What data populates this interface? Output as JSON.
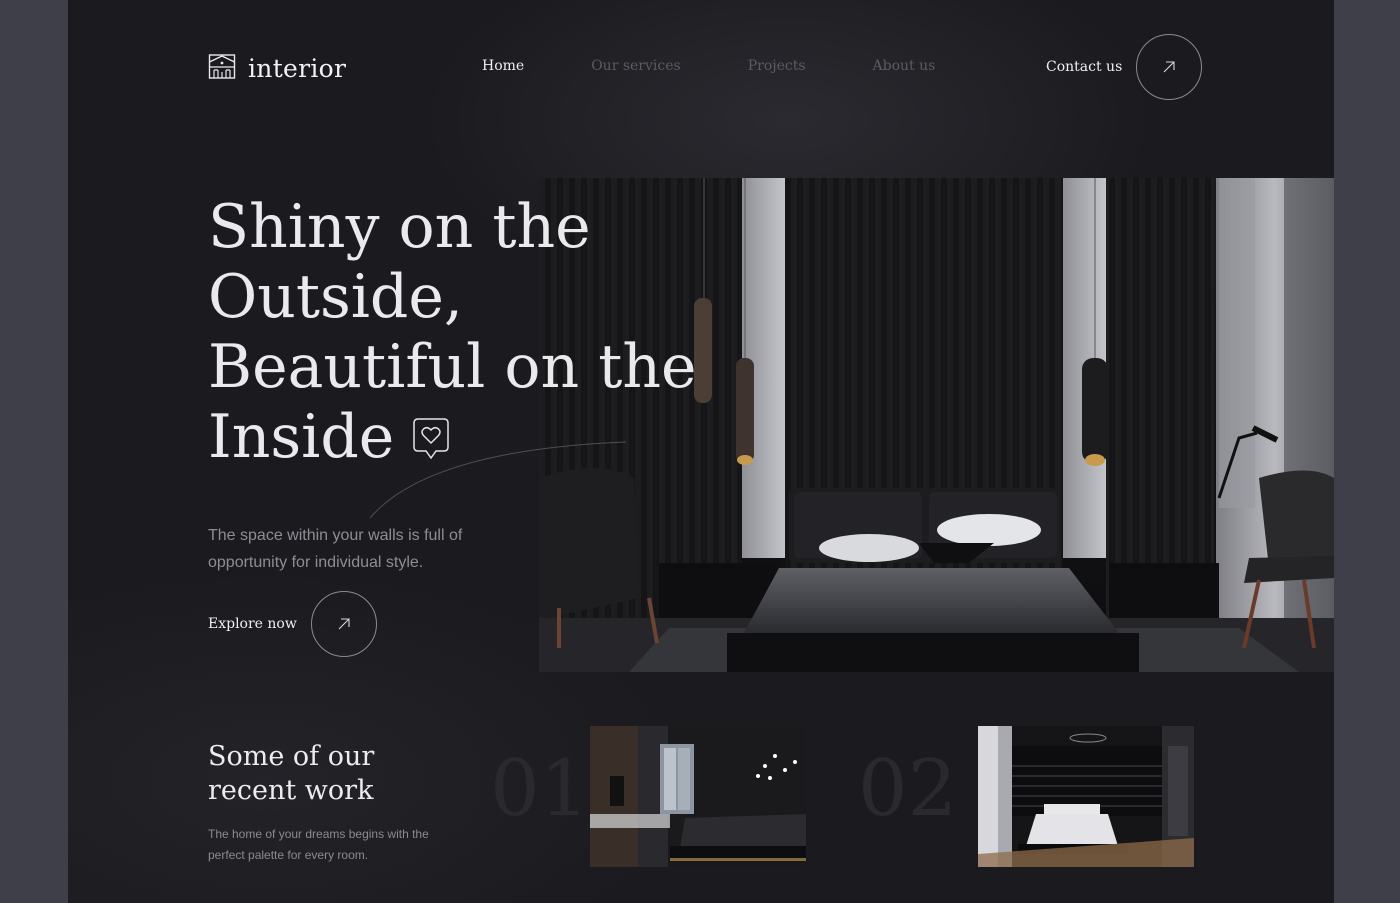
{
  "brand": {
    "name": "interior",
    "icon": "house-logo-icon"
  },
  "nav": {
    "items": [
      {
        "label": "Home",
        "active": true
      },
      {
        "label": "Our services",
        "active": false
      },
      {
        "label": "Projects",
        "active": false
      },
      {
        "label": "About us",
        "active": false
      }
    ],
    "contact_label": "Contact us",
    "contact_icon": "arrow-up-right-icon"
  },
  "hero": {
    "title_lines": [
      "Shiny on the",
      "Outside,",
      "Beautiful on the",
      "Inside"
    ],
    "title_icon": "heart-chat-icon",
    "subtitle": "The space within your walls is full of opportunity for individual style.",
    "cta_label": "Explore now",
    "cta_icon": "arrow-up-right-icon",
    "image": "dark-bedroom-photo"
  },
  "recent": {
    "title": "Some of our recent work",
    "subtitle": "The home of your dreams begins with the perfect palette for every room.",
    "items": [
      {
        "number": "01",
        "image": "bedroom-window-photo"
      },
      {
        "number": "02",
        "image": "bedroom-black-walls-photo"
      }
    ]
  },
  "colors": {
    "background": "#1b1b1f",
    "frame": "#3f3f4a",
    "text_primary": "#e9e9ee",
    "text_muted": "#5b5b64"
  }
}
